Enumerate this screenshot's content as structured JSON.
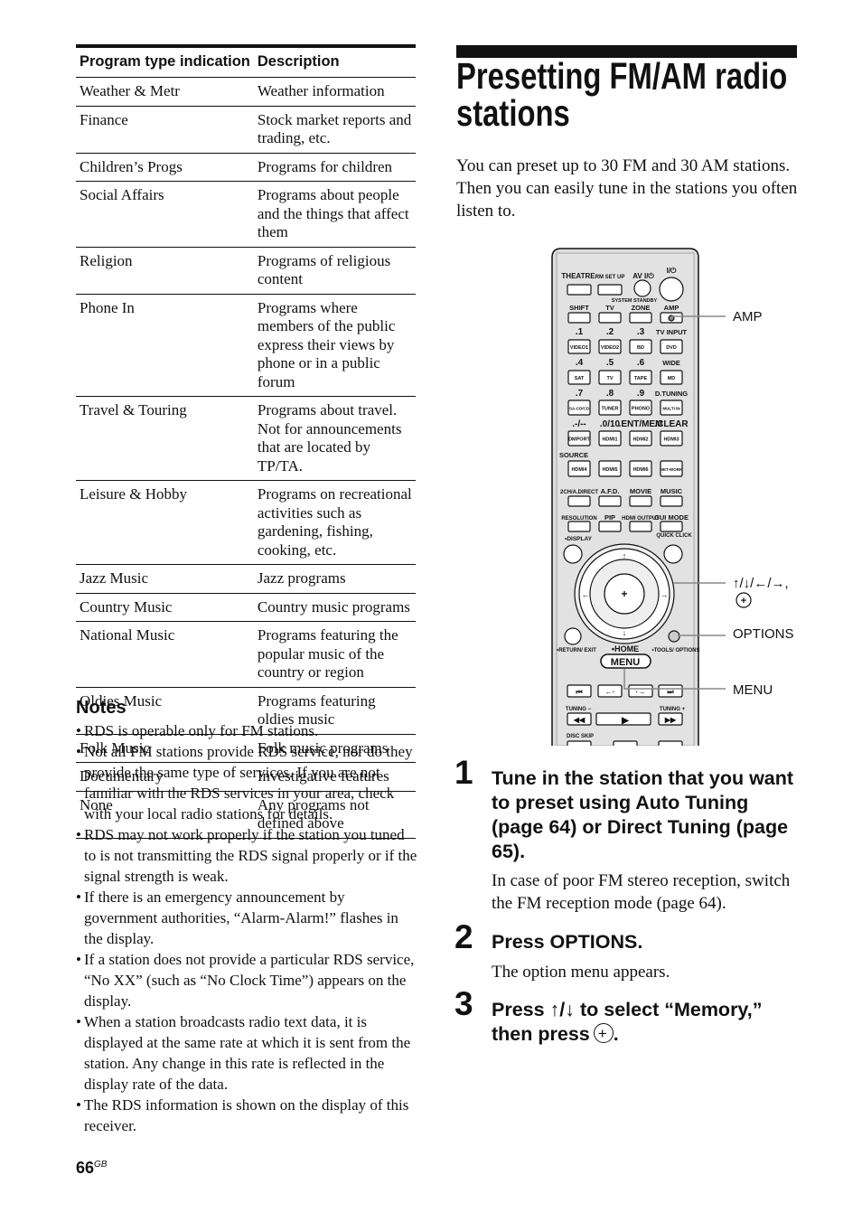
{
  "table": {
    "headers": [
      "Program type indication",
      "Description"
    ],
    "rows": [
      [
        "Weather & Metr",
        "Weather information"
      ],
      [
        "Finance",
        "Stock market reports and trading, etc."
      ],
      [
        "Children’s Progs",
        "Programs for children"
      ],
      [
        "Social Affairs",
        "Programs about people and the things that affect them"
      ],
      [
        "Religion",
        "Programs of religious content"
      ],
      [
        "Phone In",
        "Programs where members of the public express their views by phone or in a public forum"
      ],
      [
        "Travel & Touring",
        "Programs about travel. Not for announcements that are located by TP/TA."
      ],
      [
        "Leisure & Hobby",
        "Programs on recreational activities such as gardening, fishing, cooking, etc."
      ],
      [
        "Jazz Music",
        "Jazz programs"
      ],
      [
        "Country Music",
        "Country music programs"
      ],
      [
        "National Music",
        "Programs featuring the popular music of the country or region"
      ],
      [
        "Oldies Music",
        "Programs featuring oldies music"
      ],
      [
        "Folk Music",
        "Folk music programs"
      ],
      [
        "Documentary",
        "Investigative features"
      ],
      [
        "None",
        "Any programs not defined above"
      ]
    ]
  },
  "notes": {
    "heading": "Notes",
    "items": [
      "RDS is operable only for FM stations.",
      "Not all FM stations provide RDS service, nor do they provide the same type of services. If you are not familiar with the RDS services in your area, check with your local radio stations for details.",
      "RDS may not work properly if the station you tuned to is not transmitting the RDS signal properly or if the signal strength is weak.",
      "If there is an emergency announcement by government authorities, “Alarm-Alarm!” flashes in the display.",
      "If a station does not provide a particular RDS service, “No XX” (such as “No Clock Time”) appears on the display.",
      "When a station broadcasts radio text data, it is displayed at the same rate at which it is sent from the station. Any change in this rate is reflected in the display rate of the data.",
      "The RDS information is shown on the display of this receiver."
    ]
  },
  "title": "Presetting FM/AM radio stations",
  "intro": "You can preset up to 30 FM and 30 AM stations. Then you can easily tune in the stations you often listen to.",
  "remote": {
    "top": [
      "THEATRE",
      "RM SET UP",
      "AV I/⏻",
      "I/⏻",
      "SYSTEM STANDBY"
    ],
    "rows": [
      {
        "labels": [
          "SHIFT",
          "TV",
          "ZONE",
          "AMP"
        ],
        "buttons": [
          "",
          "",
          "",
          ""
        ]
      },
      {
        "labels": [
          ".1",
          ".2",
          ".3",
          "TV INPUT"
        ],
        "buttons": [
          "VIDEO1",
          "VIDEO2",
          "BD",
          "DVD"
        ]
      },
      {
        "labels": [
          ".4",
          ".5",
          ".6",
          "WIDE"
        ],
        "buttons": [
          "SAT",
          "TV",
          "TAPE",
          "MD"
        ]
      },
      {
        "labels": [
          ".7",
          ".8",
          ".9",
          "D.TUNING"
        ],
        "buttons": [
          "SA-CD/CD",
          "TUNER",
          "PHONO",
          "MULTI IN"
        ]
      },
      {
        "labels": [
          ".-/--",
          ".0/10",
          ".ENT/MEM",
          ".CLEAR"
        ],
        "buttons": [
          "DMPORT",
          "HDMI1",
          "HDMI2",
          "HDMI3"
        ]
      },
      {
        "labels": [
          "SOURCE",
          "",
          "",
          ""
        ],
        "buttons": [
          "HDMI4",
          "HDMI5",
          "HDMI6",
          "NET-WORK"
        ]
      },
      {
        "labels": [
          "2CH/A.DIRECT",
          "A.F.D.",
          "MOVIE",
          "MUSIC"
        ],
        "buttons": [
          "",
          "",
          "",
          ""
        ]
      },
      {
        "labels": [
          "RESOLUTION",
          "PIP",
          "HDMI OUTPUT",
          "GUI MODE"
        ],
        "buttons": [
          "",
          "",
          "",
          ""
        ]
      }
    ],
    "display": "•DISPLAY",
    "quick_click": "QUICK CLICK",
    "return": "•RETURN/ EXIT",
    "home": "•HOME",
    "menu": "MENU",
    "tools": "•TOOLS/ OPTIONS",
    "tuning_minus": "TUNING −",
    "tuning_plus": "TUNING +",
    "disc_skip": "DISC SKIP",
    "callouts": {
      "amp": "AMP",
      "arrows": "↑/↓/←/→,",
      "options": "OPTIONS",
      "menu": "MENU"
    }
  },
  "steps": [
    {
      "num": "1",
      "heading": "Tune in the station that you want to preset using Auto Tuning (page 64) or Direct Tuning (page 65).",
      "body": "In case of poor FM stereo reception, switch the FM reception mode (page 64)."
    },
    {
      "num": "2",
      "heading": "Press OPTIONS.",
      "body": "The option menu appears."
    },
    {
      "num": "3",
      "heading": "Press ↑/↓ to select “Memory,” then press",
      "body": ""
    }
  ],
  "page": {
    "number": "66",
    "suffix": "GB"
  }
}
